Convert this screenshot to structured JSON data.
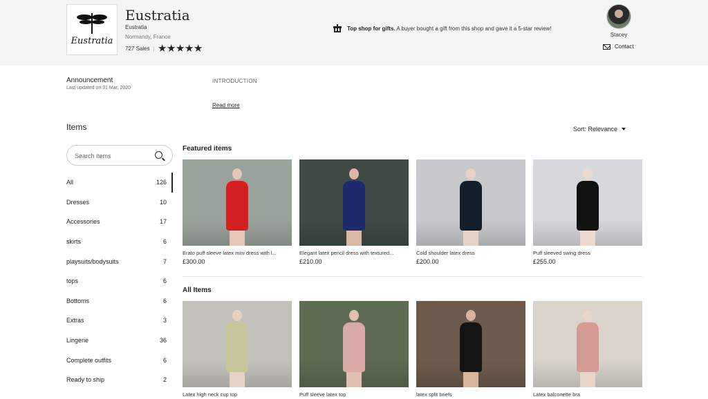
{
  "header": {
    "shop_name": "Eustratia",
    "shop_subtitle": "Eustratia",
    "location": "Normandy, France",
    "sales": "727 Sales",
    "rating_stars": 5,
    "gift_bold": "Top shop for gifts.",
    "gift_text": "A buyer bought a gift from this shop and gave it a 5-star review!",
    "owner_name": "Stacey",
    "contact_label": "Contact",
    "logo_text": "Eustratia"
  },
  "announcement": {
    "title": "Announcement",
    "updated": "Last updated on 31 Mar, 2020",
    "intro": "INTRODUCTION",
    "read_more": "Read more"
  },
  "items": {
    "heading": "Items",
    "sort_label": "Sort: Relevance",
    "search_placeholder": "Search items",
    "categories": [
      {
        "label": "All",
        "count": "126"
      },
      {
        "label": "Dresses",
        "count": "10"
      },
      {
        "label": "Accessories",
        "count": "17"
      },
      {
        "label": "skirts",
        "count": "6"
      },
      {
        "label": "playsuits/bodysuits",
        "count": "7"
      },
      {
        "label": "tops",
        "count": "6"
      },
      {
        "label": "Bottoms",
        "count": "6"
      },
      {
        "label": "Extras",
        "count": "3"
      },
      {
        "label": "Lingerie",
        "count": "36"
      },
      {
        "label": "Complete outfits",
        "count": "6"
      },
      {
        "label": "Ready to ship",
        "count": "2"
      }
    ]
  },
  "featured": {
    "title": "Featured items",
    "products": [
      {
        "title": "Erato puff sleeve latex mini dress with l...",
        "price": "£300.00",
        "bg": "#9aa39b",
        "garment": "#d41f22",
        "skin": "#e5c8b8"
      },
      {
        "title": "Elegant latex pencil dress with textured...",
        "price": "£210.00",
        "bg": "#3f4a44",
        "garment": "#1d2a6b",
        "skin": "#d9b8a7"
      },
      {
        "title": "Cold shoulder latex dress",
        "price": "£200.00",
        "bg": "#c7c9cd",
        "garment": "#141d2a",
        "skin": "#e8d2c7"
      },
      {
        "title": "Puff sleeved swing dress",
        "price": "£255.00",
        "bg": "#d7d8dc",
        "garment": "#111111",
        "skin": "#ecd9cf"
      }
    ]
  },
  "all_items": {
    "title": "All Items",
    "products": [
      {
        "title": "Latex high neck cup top",
        "bg": "#c3c1bb",
        "garment": "#c9c59a",
        "skin": "#e8d2c4"
      },
      {
        "title": "Puff sleeve latex top",
        "bg": "#5d6b51",
        "garment": "#d9aaa3",
        "skin": "#e0c0ae"
      },
      {
        "title": "latex split briefs",
        "bg": "#6d5a4a",
        "garment": "#141414",
        "skin": "#d8b49c"
      },
      {
        "title": "Latex balconette bra",
        "bg": "#d9d3cc",
        "garment": "#d39b94",
        "skin": "#ead4c7"
      }
    ]
  }
}
